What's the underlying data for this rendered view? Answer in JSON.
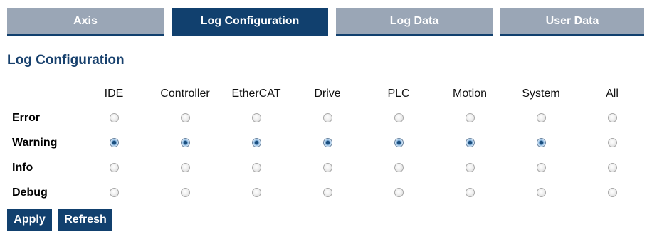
{
  "tabs": [
    {
      "label": "Axis",
      "active": false
    },
    {
      "label": "Log Configuration",
      "active": true
    },
    {
      "label": "Log Data",
      "active": false
    },
    {
      "label": "User Data",
      "active": false
    }
  ],
  "page_title": "Log Configuration",
  "columns": [
    "IDE",
    "Controller",
    "EtherCAT",
    "Drive",
    "PLC",
    "Motion",
    "System",
    "All"
  ],
  "rows": [
    {
      "label": "Error",
      "selected": [
        false,
        false,
        false,
        false,
        false,
        false,
        false,
        false
      ]
    },
    {
      "label": "Warning",
      "selected": [
        true,
        true,
        true,
        true,
        true,
        true,
        true,
        false
      ]
    },
    {
      "label": "Info",
      "selected": [
        false,
        false,
        false,
        false,
        false,
        false,
        false,
        false
      ]
    },
    {
      "label": "Debug",
      "selected": [
        false,
        false,
        false,
        false,
        false,
        false,
        false,
        false
      ]
    }
  ],
  "buttons": {
    "apply": "Apply",
    "refresh": "Refresh"
  },
  "colors": {
    "accent": "#11406e",
    "tab_inactive": "#9aa6b6",
    "title": "#17406d"
  }
}
